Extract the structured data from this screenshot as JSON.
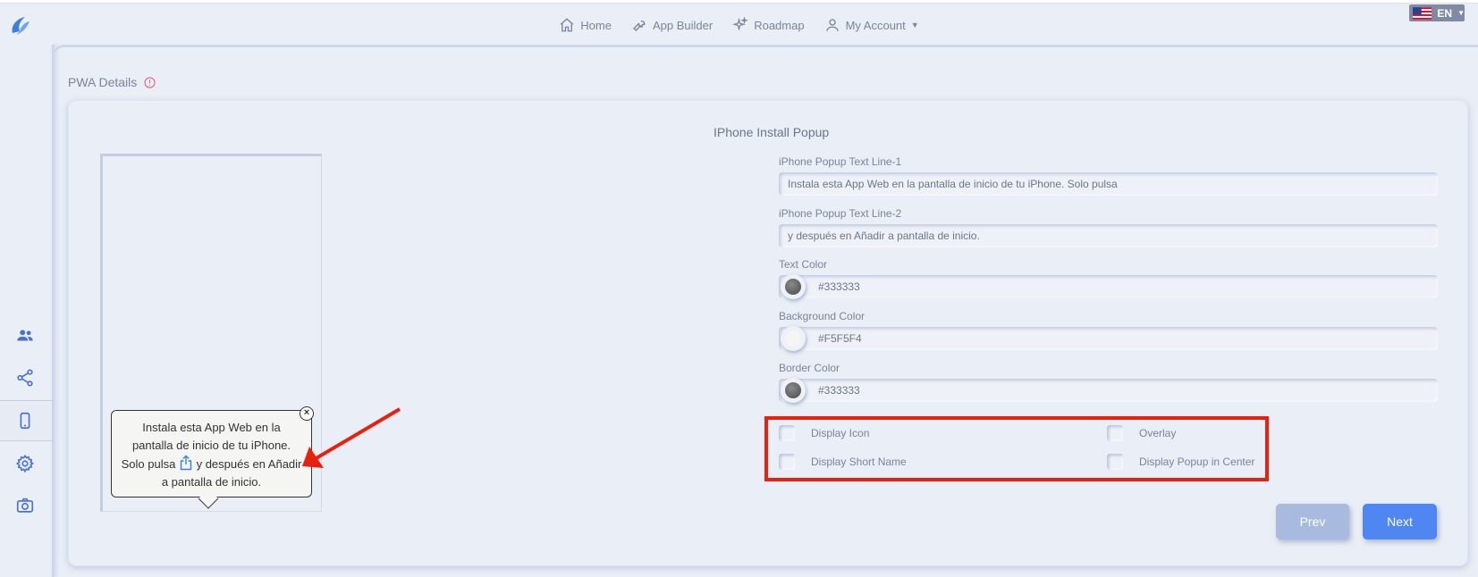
{
  "nav": {
    "home": "Home",
    "app_builder": "App Builder",
    "roadmap": "Roadmap",
    "my_account": "My Account"
  },
  "lang": {
    "code": "EN"
  },
  "section": {
    "title": "PWA Details"
  },
  "card": {
    "title": "IPhone Install Popup"
  },
  "popup_preview": {
    "line1": "Instala esta App Web en la pantalla de inicio de tu iPhone. Solo pulsa",
    "line2": "y después en Añadir a pantalla de inicio.",
    "close": "×"
  },
  "fields": {
    "line1_label": "iPhone Popup Text Line-1",
    "line1_value": "Instala esta App Web en la pantalla de inicio de tu iPhone. Solo pulsa",
    "line2_label": "iPhone Popup Text Line-2",
    "line2_value": "y después en Añadir a pantalla de inicio.",
    "text_color_label": "Text Color",
    "text_color_value": "#333333",
    "bg_color_label": "Background Color",
    "bg_color_value": "#F5F5F4",
    "border_color_label": "Border Color",
    "border_color_value": "#333333"
  },
  "checks": {
    "display_icon": "Display Icon",
    "overlay": "Overlay",
    "display_short_name": "Display Short Name",
    "display_center": "Display Popup in Center"
  },
  "buttons": {
    "prev": "Prev",
    "next": "Next"
  },
  "colors": {
    "accent": "#4f86f2",
    "prev_disabled": "#a8bbdf",
    "annotation": "#e8210f",
    "text_color": "#333333",
    "bg_color": "#f5f5f4",
    "border_color": "#333333"
  },
  "icons": {
    "logo": "brand-logo-icon",
    "home": "home-icon",
    "app_builder": "wrench-icon",
    "roadmap": "sparkles-icon",
    "account": "user-icon",
    "users": "users-icon",
    "share": "share-icon",
    "mobile": "mobile-icon",
    "settings": "gear-icon",
    "camera": "camera-icon"
  }
}
